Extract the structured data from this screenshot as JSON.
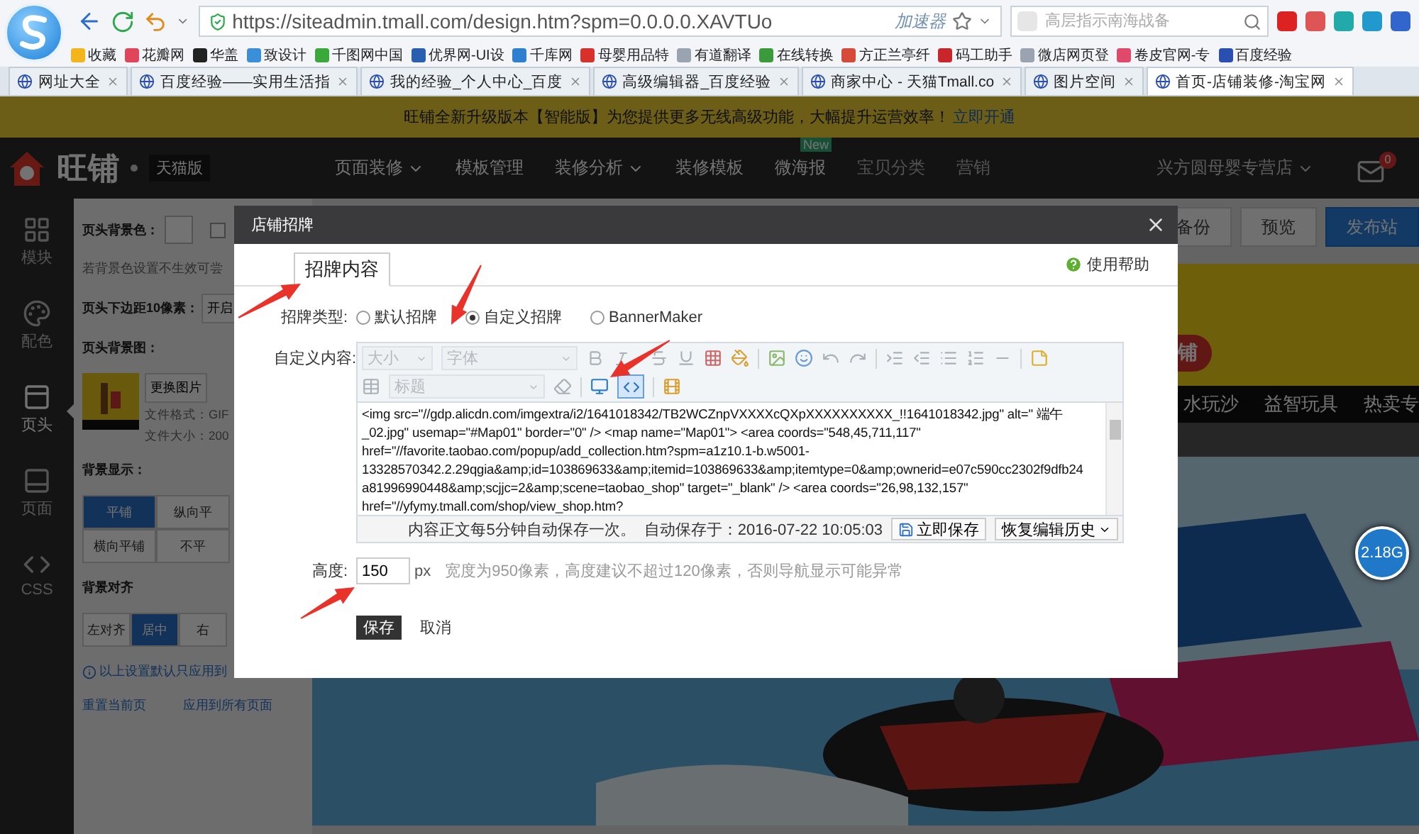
{
  "browser": {
    "address": "https://siteadmin.tmall.com/design.htm?spm=0.0.0.0.XAVTUo",
    "accelerator": "加速器",
    "search_placeholder": "高层指示南海战备",
    "bookmarks": [
      {
        "label": "收藏",
        "color": "#f2b51c"
      },
      {
        "label": "花瓣网",
        "color": "#e0455a"
      },
      {
        "label": "华盖",
        "color": "#222222"
      },
      {
        "label": "致设计",
        "color": "#3a8fd6"
      },
      {
        "label": "千图网中国",
        "color": "#3aa83a"
      },
      {
        "label": "优界网-UI设",
        "color": "#2a5fb0"
      },
      {
        "label": "千库网",
        "color": "#2f7fd0"
      },
      {
        "label": "母婴用品特",
        "color": "#d8302a"
      },
      {
        "label": "有道翻译",
        "color": "#9aa4b0"
      },
      {
        "label": "在线转换",
        "color": "#3b9a3b"
      },
      {
        "label": "方正兰亭纤",
        "color": "#d64a3a"
      },
      {
        "label": "码工助手",
        "color": "#c8262a"
      },
      {
        "label": "微店网页登",
        "color": "#9aa4b0"
      },
      {
        "label": "卷皮官网-专",
        "color": "#e04a6a"
      },
      {
        "label": "百度经验",
        "color": "#2a4fb0"
      }
    ],
    "tabs": [
      {
        "label": "网址大全",
        "selected": false
      },
      {
        "label": "百度经验——实用生活指",
        "selected": false
      },
      {
        "label": "我的经验_个人中心_百度",
        "selected": false
      },
      {
        "label": "高级编辑器_百度经验",
        "selected": false
      },
      {
        "label": "商家中心 - 天猫Tmall.co",
        "selected": false
      },
      {
        "label": "图片空间",
        "selected": false
      },
      {
        "label": "首页-店铺装修-淘宝网",
        "selected": true
      }
    ]
  },
  "notice": {
    "text": "旺铺全新升级版本【智能版】为您提供更多无线高级功能，大幅提升运营效率！",
    "link": "立即开通"
  },
  "header": {
    "logo": "旺铺",
    "edition": "天猫版",
    "shop": "兴方圆母婴专营店",
    "mail_count": "0",
    "nav": [
      {
        "label": "页面装修",
        "dropdown": true,
        "disabled": false
      },
      {
        "label": "模板管理",
        "dropdown": false,
        "disabled": false
      },
      {
        "label": "装修分析",
        "dropdown": true,
        "disabled": false
      },
      {
        "label": "装修模板",
        "dropdown": false,
        "disabled": false
      },
      {
        "label": "微海报",
        "dropdown": false,
        "disabled": false,
        "badge": "New"
      },
      {
        "label": "宝贝分类",
        "dropdown": false,
        "disabled": true
      },
      {
        "label": "营销",
        "dropdown": false,
        "disabled": true
      }
    ]
  },
  "rail": [
    {
      "label": "模块",
      "kind": "grid",
      "selected": false
    },
    {
      "label": "配色",
      "kind": "palette",
      "selected": false
    },
    {
      "label": "页头",
      "kind": "header",
      "selected": true
    },
    {
      "label": "页面",
      "kind": "page",
      "selected": false
    },
    {
      "label": "CSS",
      "kind": "code",
      "selected": false
    }
  ],
  "panel": {
    "bg_color_label": "页头背景色：",
    "bg_color_checkbox": {
      "checked": false
    },
    "bg_hint": "若背景色设置不生效可尝",
    "margin_label": "页头下边距10像素：",
    "margin_button": "开启",
    "image_label": "页头背景图：",
    "change_image": "更换图片",
    "file_format": "文件格式：GIF",
    "file_size": "文件大小：200",
    "display_label": "背景显示：",
    "display_options": [
      {
        "label": "平铺",
        "selected": true
      },
      {
        "label": "纵向平",
        "selected": false
      },
      {
        "label": "横向平铺",
        "selected": false
      },
      {
        "label": "不平",
        "selected": false
      }
    ],
    "align_label": "背景对齐",
    "align_options": [
      {
        "label": "左对齐",
        "selected": false
      },
      {
        "label": "居中",
        "selected": true
      },
      {
        "label": "右",
        "selected": false
      }
    ],
    "info": "以上设置默认只应用到",
    "reset": "重置当前页",
    "apply_all": "应用到所有页面"
  },
  "canvas": {
    "actions": [
      {
        "label": "备份",
        "primary": false
      },
      {
        "label": "预览",
        "primary": false
      },
      {
        "label": "发布站",
        "primary": true
      }
    ],
    "banner_badge": "铺",
    "nav": [
      "水玩沙",
      "益智玩具",
      "热卖专"
    ]
  },
  "widget": {
    "text": "2.18G"
  },
  "dialog": {
    "title": "店铺招牌",
    "tabs": [
      {
        "label": "招牌内容",
        "selected": true
      }
    ],
    "help": "使用帮助",
    "type_label": "招牌类型:",
    "types": [
      {
        "label": "默认招牌",
        "selected": false
      },
      {
        "label": "自定义招牌",
        "selected": true
      },
      {
        "label": "BannerMaker",
        "selected": false
      }
    ],
    "content_label": "自定义内容:",
    "toolbar": {
      "size": "大小",
      "font": "字体",
      "heading": "标题",
      "code_view": true
    },
    "code": [
      "<img src=\"//gdp.alicdn.com/imgextra/i2/1641018342/TB2WCZnpVXXXXcQXpXXXXXXXXXX_!!1641018342.jpg\" alt=\" 端午",
      "_02.jpg\" usemap=\"#Map01\" border=\"0\" /> <map name=\"Map01\"> <area coords=\"548,45,711,117\"",
      "href=\"//favorite.taobao.com/popup/add_collection.htm?spm=a1z10.1-b.w5001-",
      "13328570342.2.29qgia&amp;id=103869633&amp;itemid=103869633&amp;itemtype=0&amp;ownerid=e07c590cc2302f9dfb24",
      "a81996990448&amp;scjjc=2&amp;scene=taobao_shop\" target=\"_blank\" /> <area coords=\"26,98,132,157\"",
      "href=\"//yfymy.tmall.com/shop/view_shop.htm?"
    ],
    "autosave_note": "内容正文每5分钟自动保存一次。",
    "autosave_time": "自动保存于：2016-07-22 10:05:03",
    "save_now": "立即保存",
    "restore": "恢复编辑历史",
    "height_label": "高度:",
    "height_value": "150",
    "unit": "px",
    "height_hint": "宽度为950像素，高度建议不超过120像素，否则导航显示可能异常",
    "buttons": [
      {
        "label": "保存",
        "primary": true
      },
      {
        "label": "取消",
        "primary": false
      }
    ]
  }
}
